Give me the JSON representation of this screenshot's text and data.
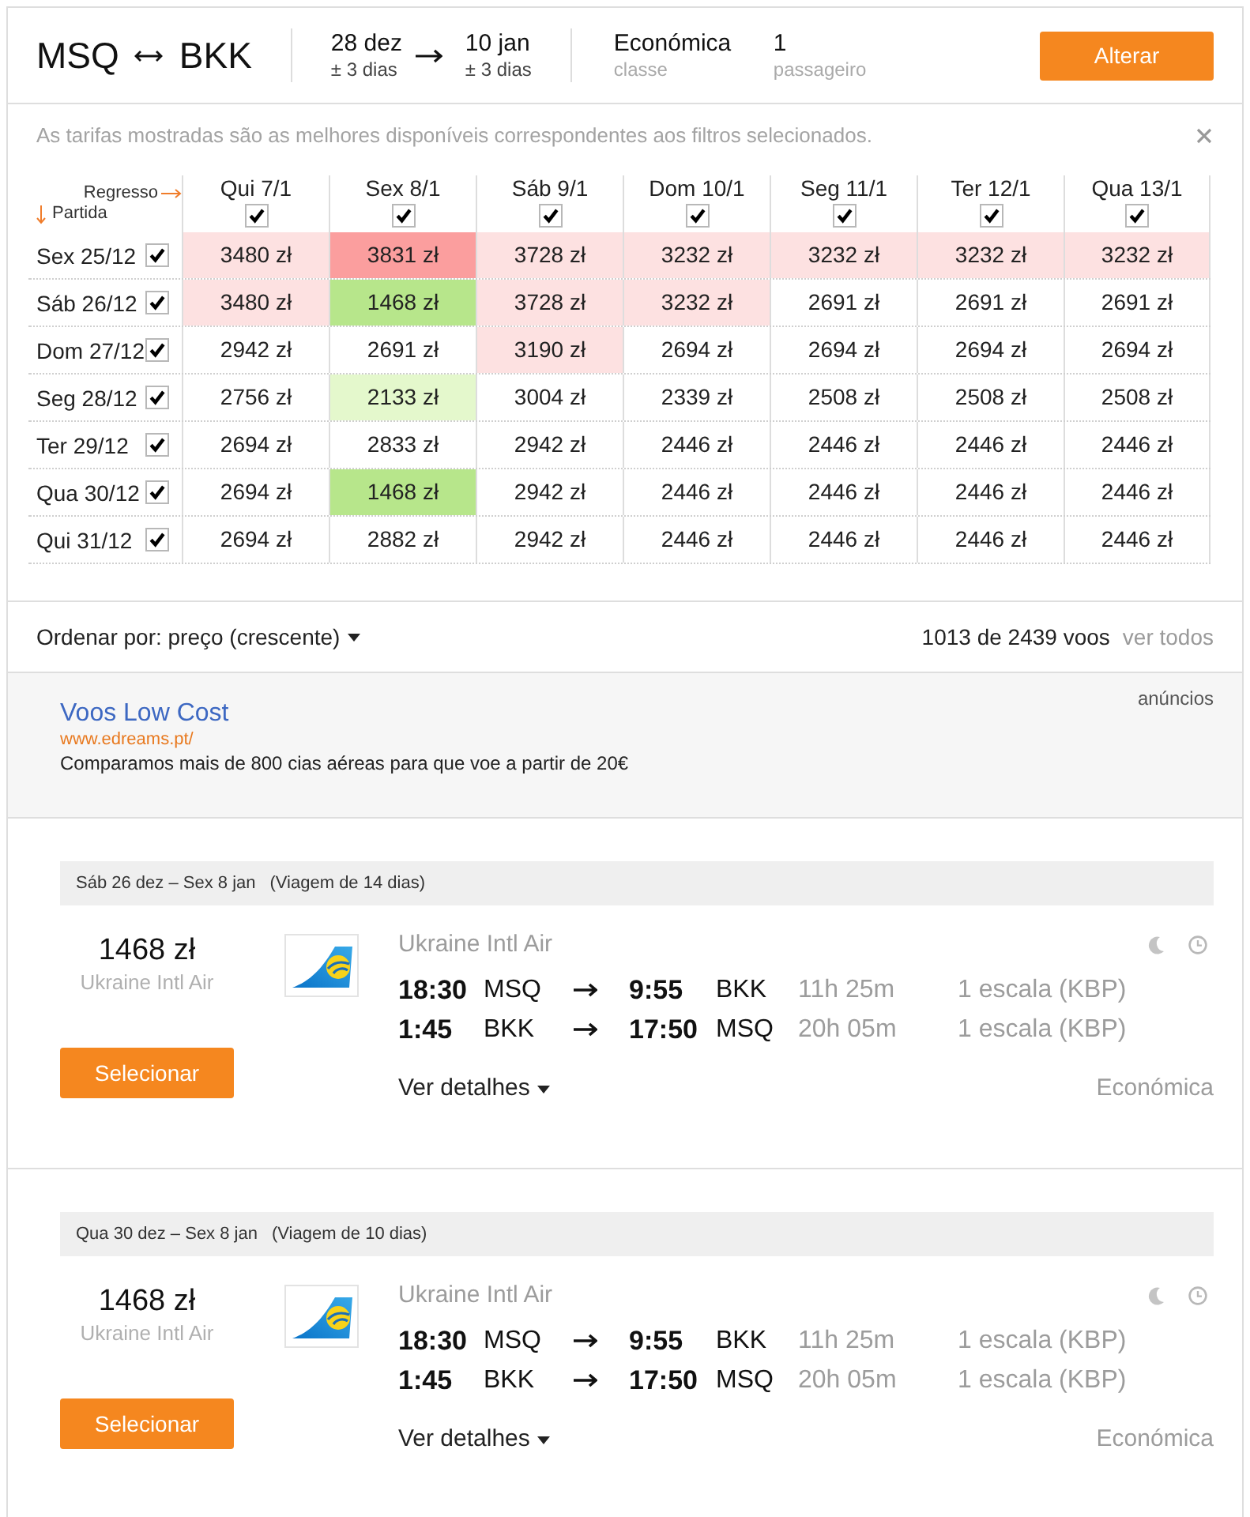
{
  "search_summary": {
    "origin": "MSQ",
    "destination": "BKK",
    "depart": {
      "date": "28 dez",
      "flex": "± 3 dias"
    },
    "return": {
      "date": "10 jan",
      "flex": "± 3 dias"
    },
    "cabin": {
      "value": "Económica",
      "label": "classe"
    },
    "passengers": {
      "value": "1",
      "label": "passageiro"
    },
    "button": "Alterar"
  },
  "fare_matrix": {
    "notice": "As tarifas mostradas são as melhores disponíveis correspondentes aos filtros selecionados.",
    "return_label": "Regresso",
    "depart_label": "Partida",
    "columns": [
      {
        "label": "Qui 7/1",
        "checked": true
      },
      {
        "label": "Sex 8/1",
        "checked": true
      },
      {
        "label": "Sáb 9/1",
        "checked": true
      },
      {
        "label": "Dom 10/1",
        "checked": true
      },
      {
        "label": "Seg 11/1",
        "checked": true
      },
      {
        "label": "Ter 12/1",
        "checked": true
      },
      {
        "label": "Qua 13/1",
        "checked": true
      }
    ],
    "rows": [
      {
        "label": "Sex 25/12",
        "checked": true,
        "cells": [
          {
            "price": "3480 zł",
            "color": "#fde1e1"
          },
          {
            "price": "3831 zł",
            "color": "#fb9e9e"
          },
          {
            "price": "3728 zł",
            "color": "#fde1e1"
          },
          {
            "price": "3232 zł",
            "color": "#fde1e1"
          },
          {
            "price": "3232 zł",
            "color": "#fde1e1"
          },
          {
            "price": "3232 zł",
            "color": "#fde1e1"
          },
          {
            "price": "3232 zł",
            "color": "#fde1e1"
          }
        ]
      },
      {
        "label": "Sáb 26/12",
        "checked": true,
        "cells": [
          {
            "price": "3480 zł",
            "color": "#fde1e1"
          },
          {
            "price": "1468 zł",
            "color": "#b7e68b"
          },
          {
            "price": "3728 zł",
            "color": "#fde1e1"
          },
          {
            "price": "3232 zł",
            "color": "#fde1e1"
          },
          {
            "price": "2691 zł"
          },
          {
            "price": "2691 zł"
          },
          {
            "price": "2691 zł"
          }
        ]
      },
      {
        "label": "Dom 27/12",
        "checked": true,
        "cells": [
          {
            "price": "2942 zł"
          },
          {
            "price": "2691 zł"
          },
          {
            "price": "3190 zł",
            "color": "#fde1e1"
          },
          {
            "price": "2694 zł"
          },
          {
            "price": "2694 zł"
          },
          {
            "price": "2694 zł"
          },
          {
            "price": "2694 zł"
          }
        ]
      },
      {
        "label": "Seg 28/12",
        "checked": true,
        "cells": [
          {
            "price": "2756 zł"
          },
          {
            "price": "2133 zł",
            "color": "#e4f8cc"
          },
          {
            "price": "3004 zł"
          },
          {
            "price": "2339 zł"
          },
          {
            "price": "2508 zł"
          },
          {
            "price": "2508 zł"
          },
          {
            "price": "2508 zł"
          }
        ]
      },
      {
        "label": "Ter 29/12",
        "checked": true,
        "cells": [
          {
            "price": "2694 zł"
          },
          {
            "price": "2833 zł"
          },
          {
            "price": "2942 zł"
          },
          {
            "price": "2446 zł"
          },
          {
            "price": "2446 zł"
          },
          {
            "price": "2446 zł"
          },
          {
            "price": "2446 zł"
          }
        ]
      },
      {
        "label": "Qua 30/12",
        "checked": true,
        "cells": [
          {
            "price": "2694 zł"
          },
          {
            "price": "1468 zł",
            "color": "#b7e68b"
          },
          {
            "price": "2942 zł"
          },
          {
            "price": "2446 zł"
          },
          {
            "price": "2446 zł"
          },
          {
            "price": "2446 zł"
          },
          {
            "price": "2446 zł"
          }
        ]
      },
      {
        "label": "Qui 31/12",
        "checked": true,
        "cells": [
          {
            "price": "2694 zł"
          },
          {
            "price": "2882 zł"
          },
          {
            "price": "2942 zł"
          },
          {
            "price": "2446 zł"
          },
          {
            "price": "2446 zł"
          },
          {
            "price": "2446 zł"
          },
          {
            "price": "2446 zł"
          }
        ]
      }
    ]
  },
  "sort_bar": {
    "label": "Ordenar por: preço (crescente)",
    "count": "1013 de 2439 voos",
    "link": "ver todos"
  },
  "ad": {
    "tag": "anúncios",
    "title": "Voos Low Cost",
    "url": "www.edreams.pt/",
    "text": "Comparamos mais de 800 cias aéreas para que voe a partir de 20€"
  },
  "results": [
    {
      "dates": "Sáb 26 dez – Sex 8 jan",
      "trip_length": "(Viagem de 14 dias)",
      "price": "1468 zł",
      "price_airline": "Ukraine Intl Air",
      "button": "Selecionar",
      "airline": "Ukraine Intl Air",
      "legs": [
        {
          "depart_time": "18:30",
          "from": "MSQ",
          "arrive_time": "9:55",
          "to": "BKK",
          "duration": "11h 25m",
          "stops": "1 escala (KBP)"
        },
        {
          "depart_time": "1:45",
          "from": "BKK",
          "arrive_time": "17:50",
          "to": "MSQ",
          "duration": "20h 05m",
          "stops": "1 escala (KBP)"
        }
      ],
      "details": "Ver detalhes",
      "cabin": "Económica"
    },
    {
      "dates": "Qua 30 dez – Sex 8 jan",
      "trip_length": "(Viagem de 10 dias)",
      "price": "1468 zł",
      "price_airline": "Ukraine Intl Air",
      "button": "Selecionar",
      "airline": "Ukraine Intl Air",
      "legs": [
        {
          "depart_time": "18:30",
          "from": "MSQ",
          "arrive_time": "9:55",
          "to": "BKK",
          "duration": "11h 25m",
          "stops": "1 escala (KBP)"
        },
        {
          "depart_time": "1:45",
          "from": "BKK",
          "arrive_time": "17:50",
          "to": "MSQ",
          "duration": "20h 05m",
          "stops": "1 escala (KBP)"
        }
      ],
      "details": "Ver detalhes",
      "cabin": "Económica"
    }
  ]
}
